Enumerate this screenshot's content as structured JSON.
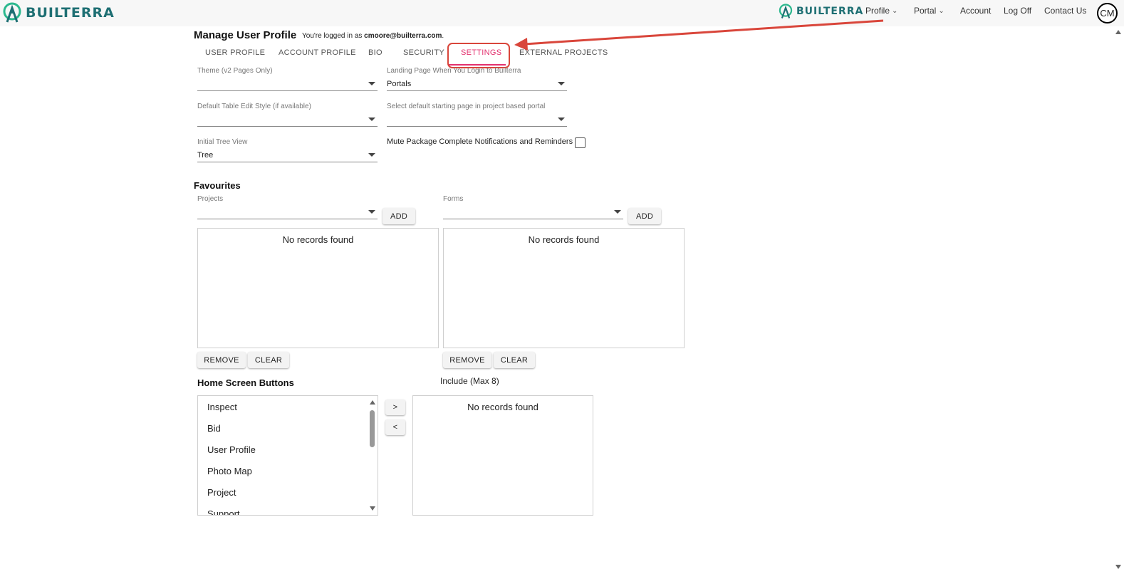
{
  "header": {
    "logo_text": "BUILTERRA",
    "secondary_logo_text": "BUILTERRA",
    "nav": [
      {
        "label": "Profile"
      },
      {
        "label": "Portal"
      },
      {
        "label": "Account"
      },
      {
        "label": "Log Off"
      },
      {
        "label": "Contact Us"
      }
    ],
    "avatar_initials": "CM"
  },
  "page": {
    "title": "Manage User Profile",
    "logged_in_prefix": "You're logged in as",
    "logged_in_user": "cmoore@builterra.com",
    "logged_in_suffix": "."
  },
  "tabs": [
    {
      "label": "USER PROFILE"
    },
    {
      "label": "ACCOUNT PROFILE"
    },
    {
      "label": "BIO"
    },
    {
      "label": "SECURITY"
    },
    {
      "label": "SETTINGS"
    },
    {
      "label": "EXTERNAL PROJECTS"
    }
  ],
  "settings": {
    "theme_label": "Theme (v2 Pages Only)",
    "theme_value": "",
    "landing_label": "Landing Page When You Login to Builterra",
    "landing_value": "Portals",
    "table_edit_label": "Default Table Edit Style (if available)",
    "table_edit_value": "",
    "starting_page_label": "Select default starting page in project based portal",
    "starting_page_value": "",
    "tree_label": "Initial Tree View",
    "tree_value": "Tree",
    "mute_label": "Mute Package Complete Notifications and Reminders"
  },
  "favourites": {
    "title": "Favourites",
    "projects_label": "Projects",
    "forms_label": "Forms",
    "add_label": "ADD",
    "empty_text": "No records found",
    "remove_label": "REMOVE",
    "clear_label": "CLEAR"
  },
  "home_buttons": {
    "title": "Home Screen Buttons",
    "include_label": "Include (Max 8)",
    "items": [
      "Inspect",
      "Bid",
      "User Profile",
      "Photo Map",
      "Project",
      "Support"
    ],
    "move_right": ">",
    "move_left": "<",
    "empty_text": "No records found"
  },
  "colors": {
    "brand": "#1e6f73",
    "active_tab": "#e3306e",
    "annotation": "#d9463b"
  }
}
